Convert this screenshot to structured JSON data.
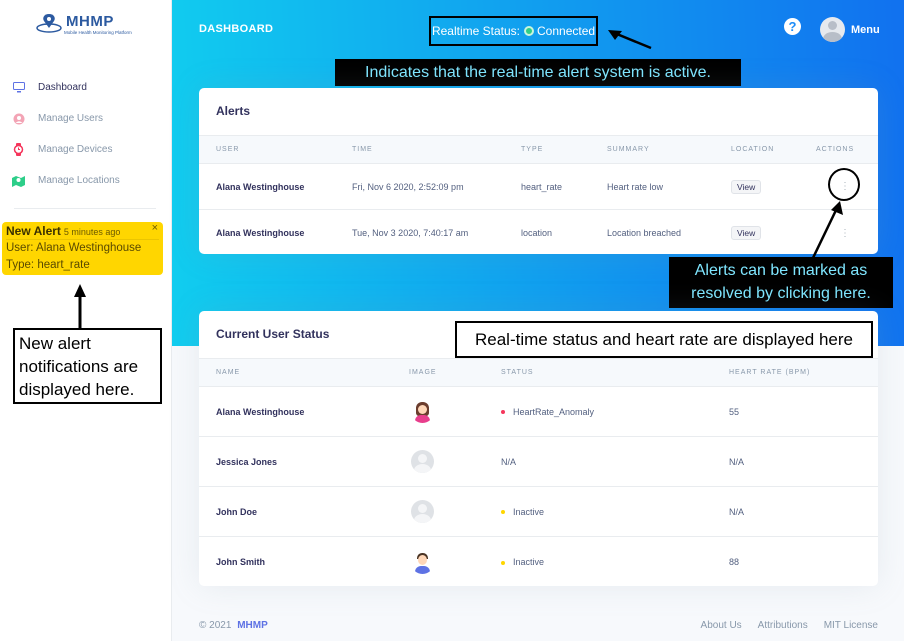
{
  "app": {
    "logo_title": "MHMP",
    "logo_subtitle": "Mobile Health Monitoring Platform"
  },
  "sidebar": {
    "items": [
      {
        "label": "Dashboard",
        "icon": "monitor-icon",
        "active": true
      },
      {
        "label": "Manage Users",
        "icon": "user-circle-icon",
        "active": false
      },
      {
        "label": "Manage Devices",
        "icon": "watch-icon",
        "active": false
      },
      {
        "label": "Manage Locations",
        "icon": "map-icon",
        "active": false
      }
    ]
  },
  "toast": {
    "title": "New Alert",
    "time_ago": "5 minutes ago",
    "close": "×",
    "user_line": "User: Alana Westinghouse",
    "type_line": "Type: heart_rate",
    "color": "#ffd600"
  },
  "header": {
    "page_label": "DASHBOARD",
    "realtime_label": "Realtime Status:",
    "realtime_value": "Connected",
    "help": "?",
    "menu_label": "Menu",
    "gradient_start": "#11cdef",
    "gradient_end": "#1171ef"
  },
  "annotations": {
    "top": "Indicates that the real-time alert system is active.",
    "right_line1": "Alerts can be marked as",
    "right_line2": "resolved by clicking here.",
    "status": "Real-time status and heart rate are displayed here",
    "left_line1": "New alert",
    "left_line2": "notifications are",
    "left_line3": "displayed here."
  },
  "alerts": {
    "title": "Alerts",
    "columns": [
      "USER",
      "TIME",
      "TYPE",
      "SUMMARY",
      "LOCATION",
      "ACTIONS"
    ],
    "rows": [
      {
        "user": "Alana Westinghouse",
        "time": "Fri, Nov 6 2020, 2:52:09 pm",
        "type": "heart_rate",
        "summary": "Heart rate low",
        "location": "View"
      },
      {
        "user": "Alana Westinghouse",
        "time": "Tue, Nov 3 2020, 7:40:17 am",
        "type": "location",
        "summary": "Location breached",
        "location": "View"
      }
    ]
  },
  "users": {
    "title": "Current User Status",
    "columns": [
      "NAME",
      "IMAGE",
      "STATUS",
      "HEART RATE (BPM)"
    ],
    "rows": [
      {
        "name": "Alana Westinghouse",
        "image": "female-avatar",
        "status": "HeartRate_Anomaly",
        "status_color": "#f5365c",
        "heart_rate": "55"
      },
      {
        "name": "Jessica Jones",
        "image": "placeholder-avatar",
        "status": "N/A",
        "status_color": "",
        "heart_rate": "N/A"
      },
      {
        "name": "John Doe",
        "image": "placeholder-avatar",
        "status": "Inactive",
        "status_color": "#ffd600",
        "heart_rate": "N/A"
      },
      {
        "name": "John Smith",
        "image": "male-avatar",
        "status": "Inactive",
        "status_color": "#ffd600",
        "heart_rate": "88"
      }
    ]
  },
  "footer": {
    "copyright": "© 2021",
    "brand": "MHMP",
    "links": [
      "About Us",
      "Attributions",
      "MIT License"
    ]
  }
}
